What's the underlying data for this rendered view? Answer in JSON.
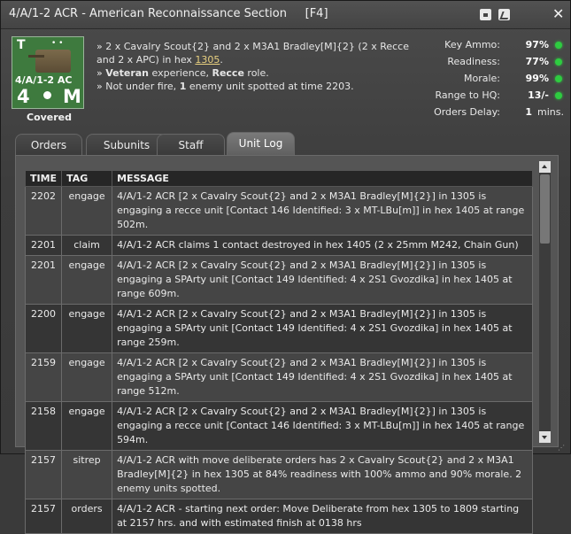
{
  "window": {
    "title": "4/A/1-2 ACR - American Reconnaissance Section",
    "hotkey": "[F4]"
  },
  "unit": {
    "counter": {
      "type_letter": "T",
      "code": "4/A/1-2 AC",
      "strength": "4",
      "move_type": "M"
    },
    "status": "Covered",
    "lines": [
      {
        "pre": "» 2 x Cavalry Scout{2} and 2 x M3A1 Bradley[M]{2} (2 x Recce and 2 x APC) in hex ",
        "hex": "1305",
        "post": "."
      },
      {
        "pre": "» ",
        "b1": "Veteran",
        "mid": " experience, ",
        "b2": "Recce",
        "post": " role."
      },
      {
        "pre": "» Not under fire, ",
        "b1": "1",
        "post": " enemy unit spotted at time 2203."
      }
    ]
  },
  "stats": [
    {
      "label": "Key Ammo:",
      "value": "97%",
      "status_color": "#2ecc40"
    },
    {
      "label": "Readiness:",
      "value": "77%",
      "status_color": "#2ecc40"
    },
    {
      "label": "Morale:",
      "value": "99%",
      "status_color": "#2ecc40"
    },
    {
      "label": "Range to HQ:",
      "value": "13/-",
      "status_color": "#2ecc40"
    },
    {
      "label": "Orders Delay:",
      "value": "1",
      "unit": "mins."
    }
  ],
  "tabs": [
    {
      "label": "Orders"
    },
    {
      "label": "Subunits"
    },
    {
      "label": "Staff"
    },
    {
      "label": "Unit Log",
      "active": true
    }
  ],
  "log": {
    "headers": [
      "TIME",
      "TAG",
      "MESSAGE"
    ],
    "rows": [
      {
        "time": "2202",
        "tag": "engage",
        "message": "4/A/1-2 ACR [2 x Cavalry Scout{2} and 2 x M3A1 Bradley[M]{2}] in 1305 is engaging a recce unit [Contact 146 Identified: 3 x MT-LBu[m]] in hex 1405 at range 502m."
      },
      {
        "time": "2201",
        "tag": "claim",
        "message": "4/A/1-2 ACR claims 1 contact destroyed in hex 1405 (2 x 25mm M242, Chain Gun)"
      },
      {
        "time": "2201",
        "tag": "engage",
        "message": "4/A/1-2 ACR [2 x Cavalry Scout{2} and 2 x M3A1 Bradley[M]{2}] in 1305 is engaging a SPArty unit [Contact 149 Identified: 4 x 2S1 Gvozdika] in hex 1405 at range 609m."
      },
      {
        "time": "2200",
        "tag": "engage",
        "message": "4/A/1-2 ACR [2 x Cavalry Scout{2} and 2 x M3A1 Bradley[M]{2}] in 1305 is engaging a SPArty unit [Contact 149 Identified: 4 x 2S1 Gvozdika] in hex 1405 at range 259m."
      },
      {
        "time": "2159",
        "tag": "engage",
        "message": "4/A/1-2 ACR [2 x Cavalry Scout{2} and 2 x M3A1 Bradley[M]{2}] in 1305 is engaging a SPArty unit [Contact 149 Identified: 4 x 2S1 Gvozdika] in hex 1405 at range 512m."
      },
      {
        "time": "2158",
        "tag": "engage",
        "message": "4/A/1-2 ACR [2 x Cavalry Scout{2} and 2 x M3A1 Bradley[M]{2}] in 1305 is engaging a recce unit [Contact 146 Identified: 3 x MT-LBu[m]] in hex 1405 at range 594m."
      },
      {
        "time": "2157",
        "tag": "sitrep",
        "message": "4/A/1-2 ACR with move deliberate orders has 2 x Cavalry Scout{2} and 2 x M3A1 Bradley[M]{2} in hex 1305 at 84% readiness with 100% ammo and 90% morale. 2 enemy units spotted."
      },
      {
        "time": "2157",
        "tag": "orders",
        "message": "4/A/1-2 ACR - starting next order: Move Deliberate from hex 1305 to 1809 starting at 2157 hrs. and with estimated finish at 0138 hrs"
      }
    ]
  }
}
